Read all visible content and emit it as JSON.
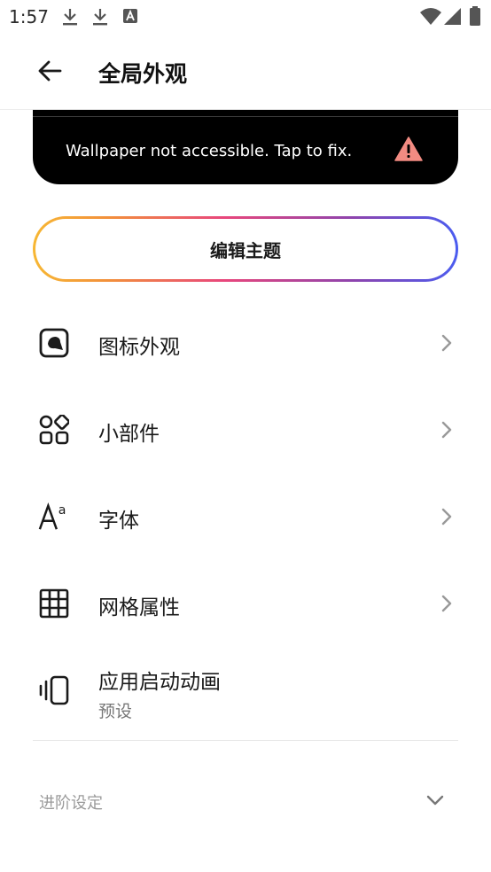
{
  "status_bar": {
    "time": "1:57",
    "icons": [
      "download-icon",
      "download-icon",
      "a-notification-icon",
      "wifi-icon",
      "signal-icon",
      "battery-icon"
    ]
  },
  "app_bar": {
    "title": "全局外观",
    "back_icon": "arrow-left-icon"
  },
  "wallpaper_banner": {
    "message": "Wallpaper not accessible. Tap to fix.",
    "icon": "warning-icon",
    "warning_color": "#f28b82"
  },
  "edit_theme": {
    "label": "编辑主题"
  },
  "settings": [
    {
      "label": "图标外观",
      "icon": "icon-style-icon"
    },
    {
      "label": "小部件",
      "icon": "widgets-icon"
    },
    {
      "label": "字体",
      "icon": "font-icon"
    },
    {
      "label": "网格属性",
      "icon": "grid-icon"
    },
    {
      "label": "应用启动动画",
      "sublabel": "预设",
      "icon": "launch-animation-icon"
    }
  ],
  "advanced": {
    "label": "进阶设定",
    "icon": "chevron-down-icon"
  }
}
